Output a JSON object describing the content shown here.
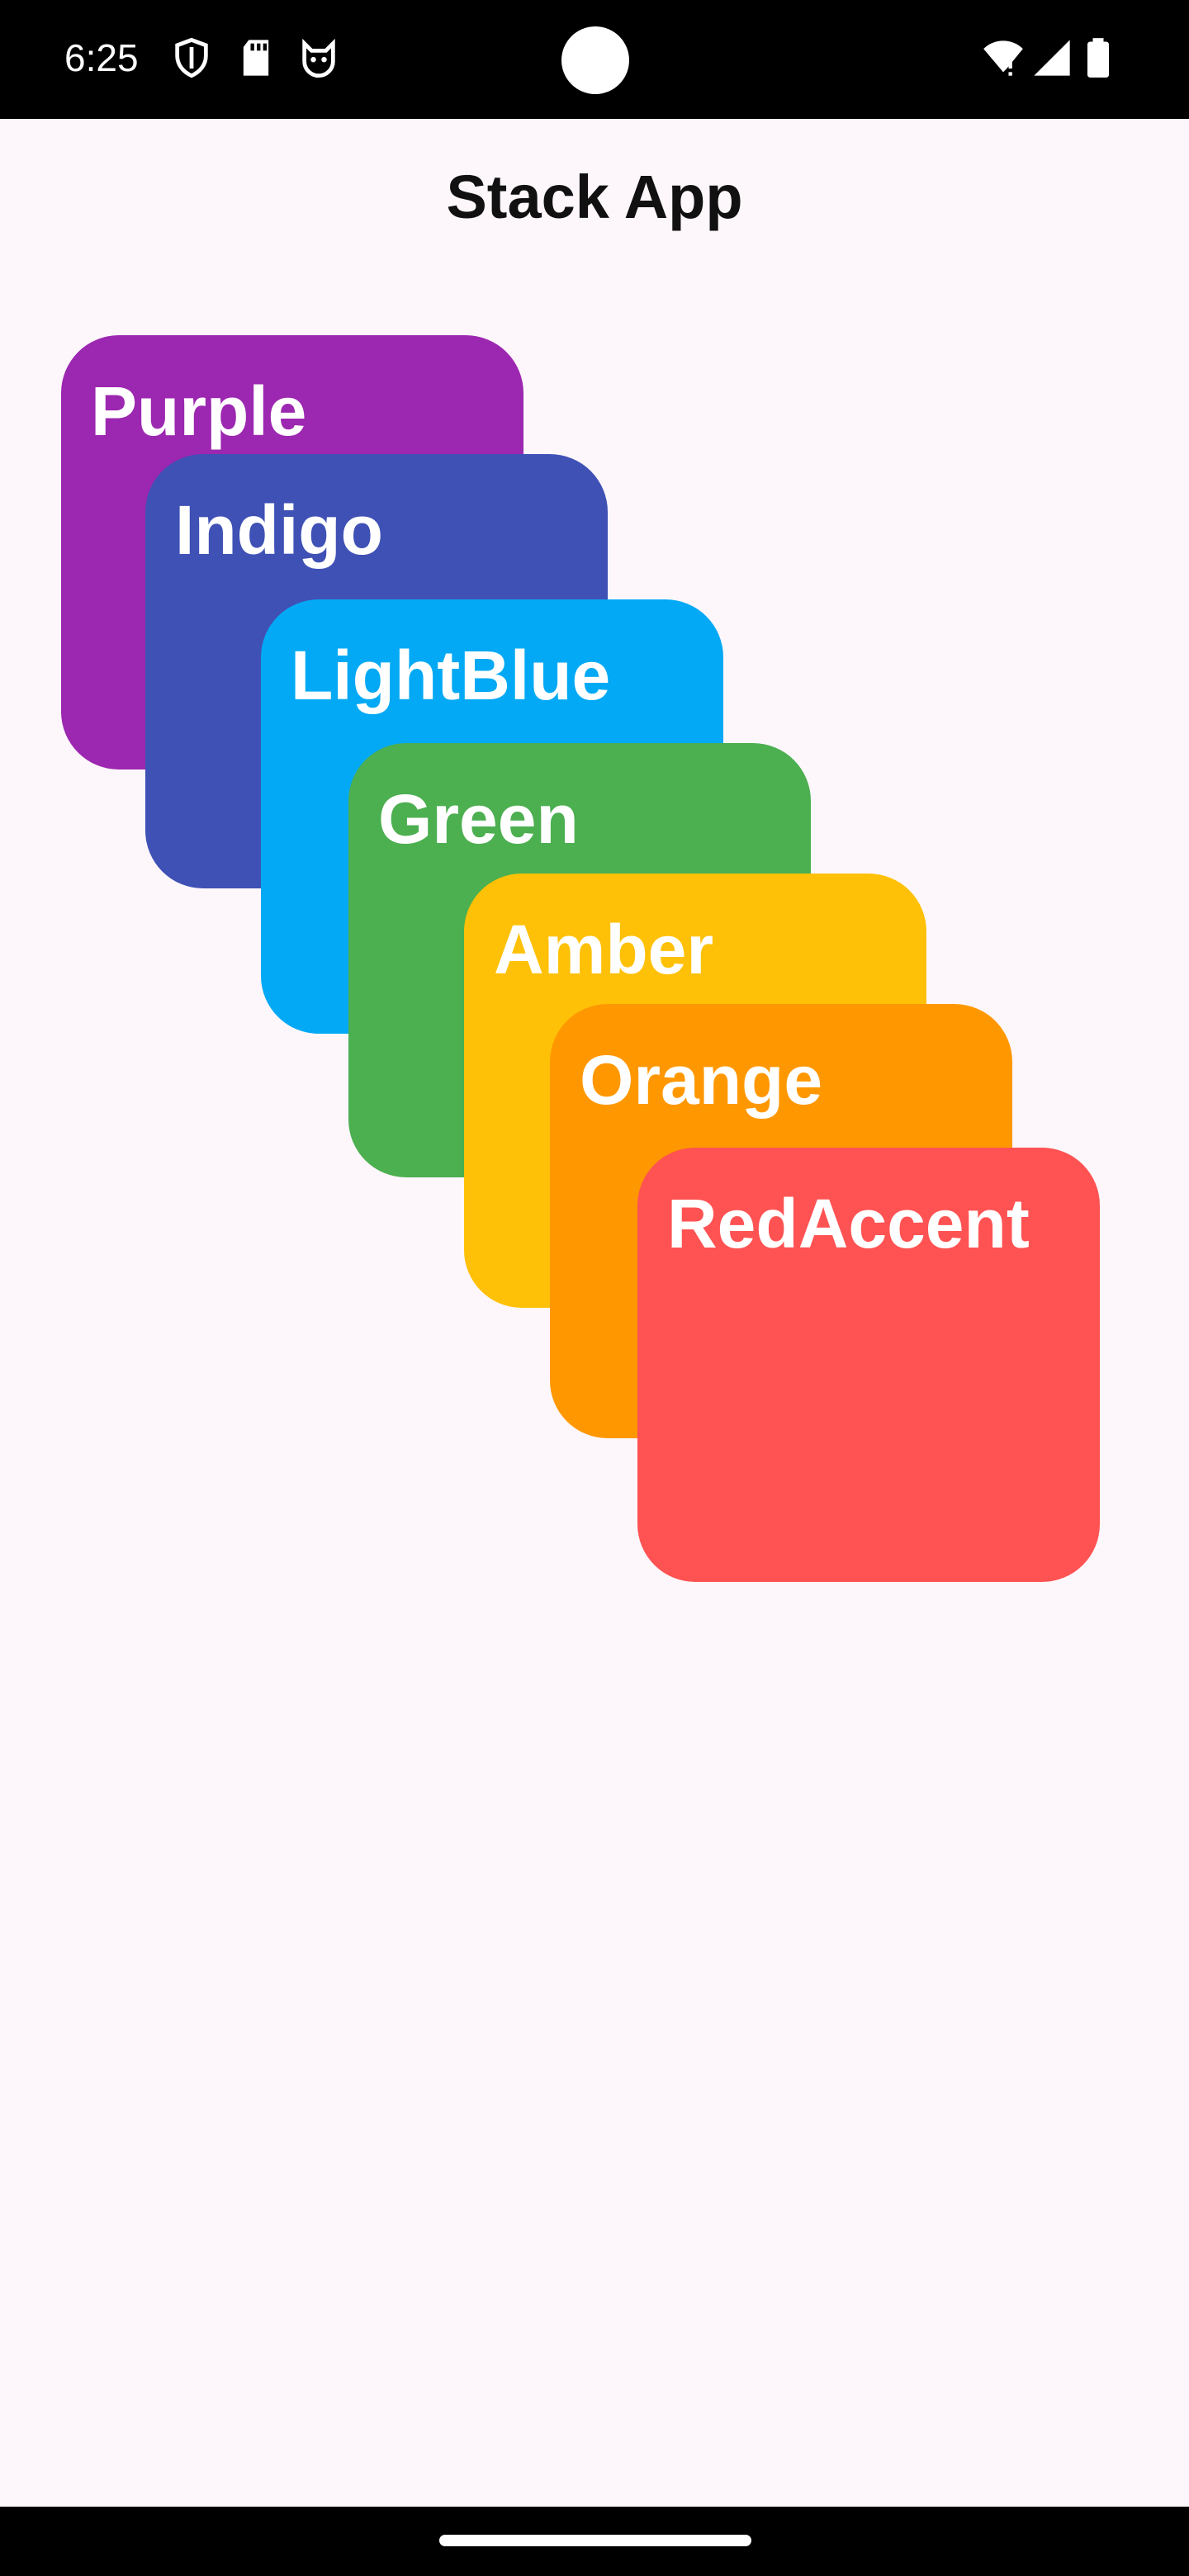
{
  "status_bar": {
    "time": "6:25",
    "icons_left": [
      "shield-icon",
      "sd-card-icon",
      "cat-face-icon"
    ],
    "icons_right": [
      "wifi-icon",
      "signal-icon",
      "battery-icon"
    ]
  },
  "app": {
    "title": "Stack App",
    "background_color": "#fdf7fb"
  },
  "cards": [
    {
      "label": "Purple",
      "color": "#9c27b0"
    },
    {
      "label": "Indigo",
      "color": "#3f51b5"
    },
    {
      "label": "LightBlue",
      "color": "#03a9f4"
    },
    {
      "label": "Green",
      "color": "#4caf50"
    },
    {
      "label": "Amber",
      "color": "#ffc107"
    },
    {
      "label": "Orange",
      "color": "#ff9800"
    },
    {
      "label": "RedAccent",
      "color": "#ff5252"
    }
  ]
}
